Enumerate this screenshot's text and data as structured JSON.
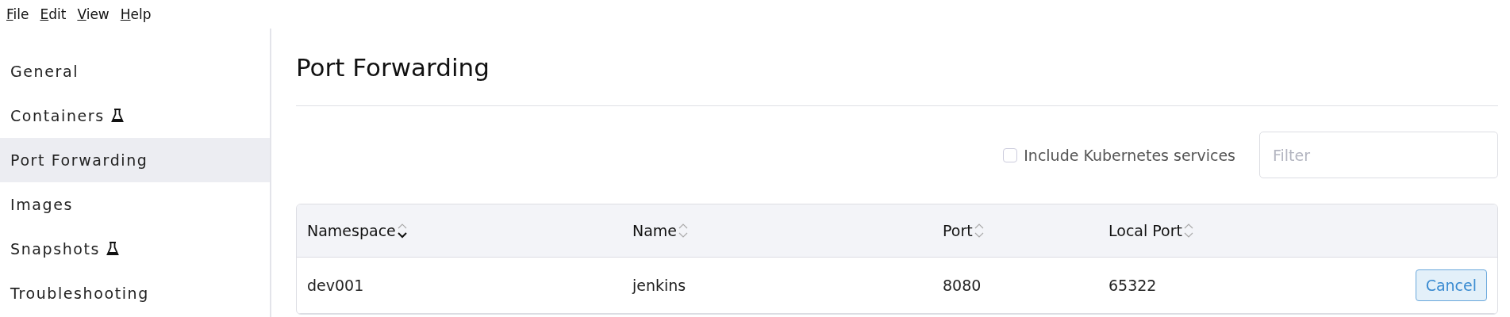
{
  "menu": [
    "File",
    "Edit",
    "View",
    "Help"
  ],
  "sidebar": {
    "items": [
      {
        "label": "General",
        "experimental": false,
        "selected": false
      },
      {
        "label": "Containers",
        "experimental": true,
        "selected": false
      },
      {
        "label": "Port Forwarding",
        "experimental": false,
        "selected": true
      },
      {
        "label": "Images",
        "experimental": false,
        "selected": false
      },
      {
        "label": "Snapshots",
        "experimental": true,
        "selected": false
      },
      {
        "label": "Troubleshooting",
        "experimental": false,
        "selected": false
      }
    ]
  },
  "page_title": "Port Forwarding",
  "include_kubernetes": {
    "label": "Include Kubernetes services",
    "checked": false
  },
  "filter": {
    "placeholder": "Filter"
  },
  "table": {
    "columns": [
      {
        "label": "Namespace",
        "sorted_descending": true
      },
      {
        "label": "Name",
        "sorted_descending": false
      },
      {
        "label": "Port",
        "sorted_descending": false
      },
      {
        "label": "Local Port",
        "sorted_descending": false
      }
    ],
    "rows": [
      {
        "cells": [
          "dev001",
          "jenkins",
          "8080",
          "65322"
        ],
        "action": "Cancel"
      }
    ]
  }
}
